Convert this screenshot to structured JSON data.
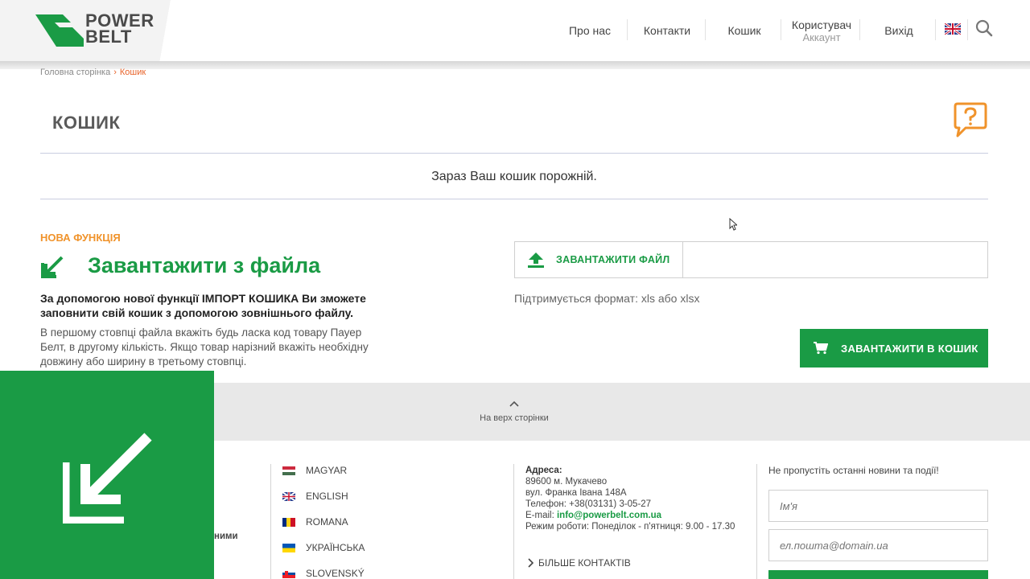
{
  "header": {
    "logo": {
      "line1": "POWER",
      "line2": "BELT"
    },
    "nav": {
      "about": "Про нас",
      "contacts": "Контакти",
      "cart": "Кошик",
      "user": "Користувач",
      "account": "Аккаунт",
      "logout": "Вихід"
    },
    "language_icon": "uk-flag-icon",
    "search_icon": "search-icon"
  },
  "breadcrumb": {
    "home": "Головна сторінка",
    "current": "Кошик"
  },
  "page": {
    "title": "КОШИК",
    "empty_message": "Зараз Ваш кошик порожній."
  },
  "import": {
    "badge": "НОВА ФУНКЦІЯ",
    "title": "Завантажити з файла",
    "lead": "За допомогою нової функції ІМПОРТ КОШИКА Ви зможете заповнити свій кошик з допомогою зовнішнього файлу.",
    "description": "В першому стовпці файла вкажіть будь ласка код товару Пауер Белт, в другому кількість. Якщо товар нарізний вкажіть необхідну довжину або ширину в третьому стовпці.",
    "upload_label": "ЗАВАНТАЖИТИ ФАЙЛ",
    "file_value": "",
    "supported_formats": "Підтримується формат: xls або xlsx",
    "add_to_cart_label": "ЗАВАНТАЖИТИ В КОШИК"
  },
  "back_to_top": "На верх сторінки",
  "footer": {
    "partial_text": "ними",
    "languages": [
      "MAGYAR",
      "ENGLISH",
      "ROMANA",
      "УКРАЇНСЬКА",
      "SLOVENSKÝ"
    ],
    "address": {
      "heading": "Адреса:",
      "line1": "89600 м. Мукачево",
      "line2": "вул. Франка Івана 148А",
      "phone": "Телефон: +38(03131) 3-05-27",
      "email_label": "E-mail: ",
      "email": "info@powerbelt.com.ua",
      "hours": "Режим роботи: Понеділок - п'ятниця: 9.00 - 17.30"
    },
    "more_contacts": "БІЛЬШЕ КОНТАКТІВ",
    "newsletter": {
      "title": "Не пропустіть останні новини та події!",
      "name_placeholder": "Ім'я",
      "email_placeholder": "ел.пошта@domain.ua"
    }
  },
  "colors": {
    "brand_green": "#1a9b45",
    "accent_orange": "#e8632a",
    "badge_orange": "#f0932b"
  }
}
